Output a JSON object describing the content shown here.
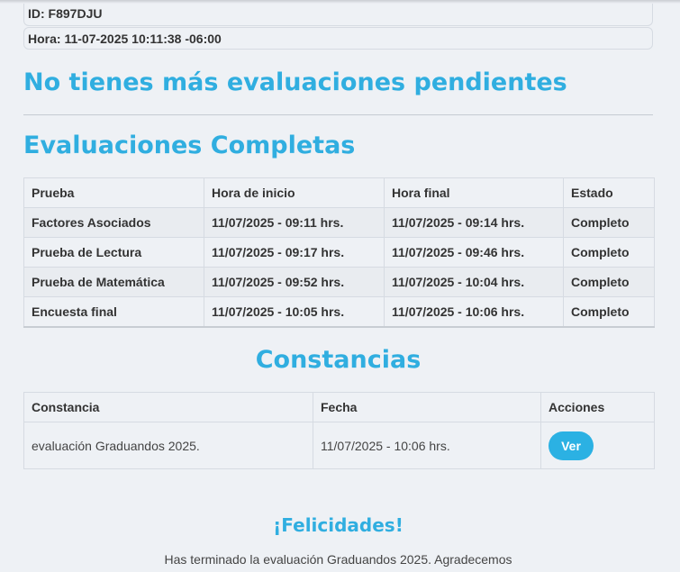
{
  "info": {
    "id_text": "ID: F897DJU",
    "time_text": "Hora: 11-07-2025 10:11:38 -06:00"
  },
  "pending_title": "No tienes más evaluaciones pendientes",
  "completed": {
    "title": "Evaluaciones Completas",
    "headers": [
      "Prueba",
      "Hora de inicio",
      "Hora final",
      "Estado"
    ],
    "rows": [
      [
        "Factores Asociados",
        "11/07/2025 - 09:11 hrs.",
        "11/07/2025 - 09:14 hrs.",
        "Completo"
      ],
      [
        "Prueba de Lectura",
        "11/07/2025 - 09:17 hrs.",
        "11/07/2025 - 09:46 hrs.",
        "Completo"
      ],
      [
        "Prueba de Matemática",
        "11/07/2025 - 09:52 hrs.",
        "11/07/2025 - 10:04 hrs.",
        "Completo"
      ],
      [
        "Encuesta final",
        "11/07/2025 - 10:05 hrs.",
        "11/07/2025 - 10:06 hrs.",
        "Completo"
      ]
    ]
  },
  "certificates": {
    "title": "Constancias",
    "headers": [
      "Constancia",
      "Fecha",
      "Acciones"
    ],
    "rows": [
      {
        "name": "evaluación Graduandos 2025.",
        "date": "11/07/2025 - 10:06 hrs.",
        "action_label": "Ver"
      }
    ]
  },
  "congrats": {
    "title": "¡Felicidades!",
    "message": "Has terminado la evaluación Graduandos 2025. Agradecemos"
  },
  "colors": {
    "accent": "#30aee0",
    "button": "#2bb1e3",
    "background": "#eef1f5"
  }
}
